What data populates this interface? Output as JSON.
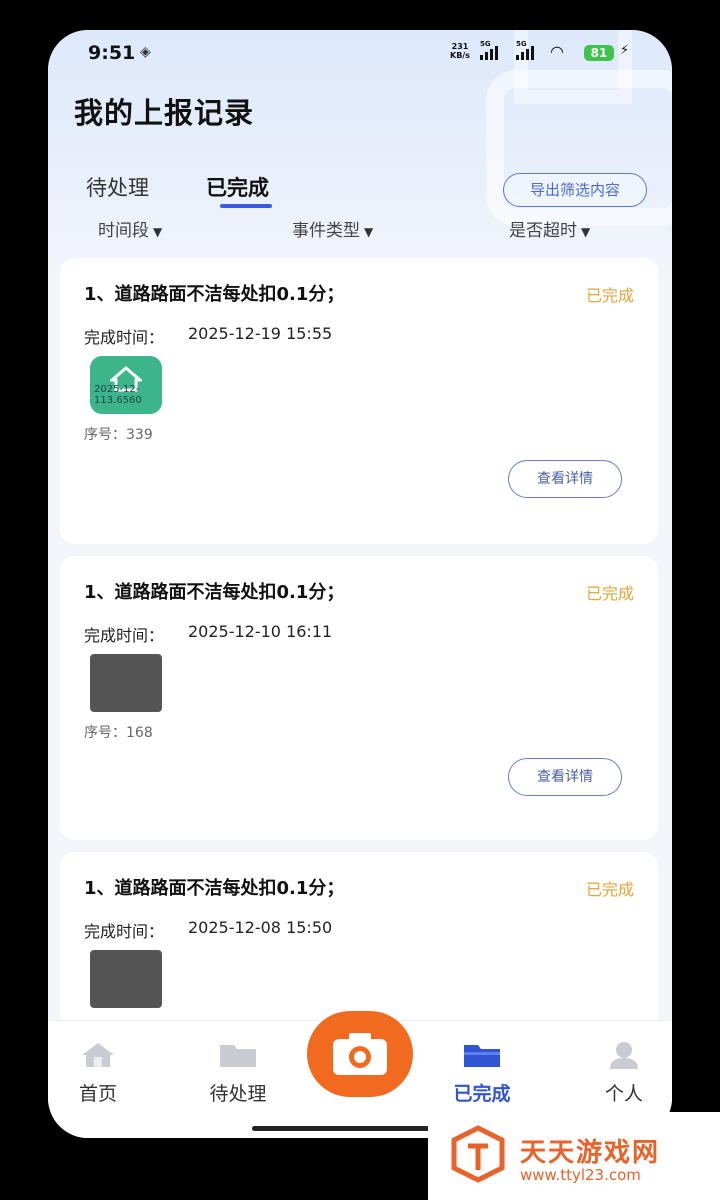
{
  "status_bar": {
    "time": "9:51",
    "net_speed_value": "231",
    "net_speed_unit": "KB/s",
    "sim1": "5G",
    "sim2": "5G",
    "battery": "81"
  },
  "page": {
    "title": "我的上报记录"
  },
  "tabs": [
    {
      "label": "待处理"
    },
    {
      "label": "已完成",
      "active": true
    }
  ],
  "export_button": "导出筛选内容",
  "filters": [
    {
      "label": "时间段"
    },
    {
      "label": "事件类型"
    },
    {
      "label": "是否超时"
    }
  ],
  "records": [
    {
      "title": "1、道路路面不洁每处扣0.1分；",
      "status": "已完成",
      "time_label": "完成时间：",
      "time": "2025-12-19 15:55",
      "thumb_text": "2025-12-\n113.6560",
      "serial": "序号：339",
      "detail": "查看详情"
    },
    {
      "title": "1、道路路面不洁每处扣0.1分；",
      "status": "已完成",
      "time_label": "完成时间：",
      "time": "2025-12-10 16:11",
      "serial": "序号：168",
      "detail": "查看详情"
    },
    {
      "title": "1、道路路面不洁每处扣0.1分；",
      "status": "已完成",
      "time_label": "完成时间：",
      "time": "2025-12-08 15:50"
    }
  ],
  "tabbar": [
    {
      "label": "首页",
      "icon": "home-icon"
    },
    {
      "label": "待处理",
      "icon": "folder-icon"
    },
    {
      "label": "",
      "icon": "camera-icon"
    },
    {
      "label": "已完成",
      "icon": "folder-icon",
      "active": true
    },
    {
      "label": "个人",
      "icon": "user-icon"
    }
  ],
  "watermark": {
    "name": "天天游戏网",
    "url": "www.ttyl23.com"
  },
  "colors": {
    "accent": "#2f54d4",
    "status_done": "#e8a33a",
    "camera": "#f26a1f",
    "brand": "#e8622a"
  }
}
